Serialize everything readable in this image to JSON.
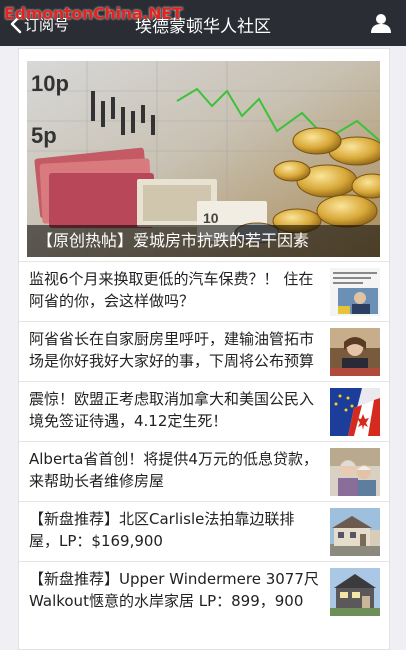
{
  "watermark": "EdmontonChina.NET",
  "nav": {
    "back_label": "订阅号",
    "title": "埃德蒙顿华人社区"
  },
  "hero": {
    "caption": "【原创热帖】爱城房市抗跌的若干因素",
    "chart_ticks": [
      "10p",
      "5p"
    ]
  },
  "articles": [
    {
      "title": "监视6个月来换取更低的汽车保费？！ 住在阿省的你，会这样做吗？",
      "thumb_icon": "news-screenshot-thumbnail"
    },
    {
      "title": "阿省省长在自家厨房里呼吁，建输油管拓市场是你好我好大家好的事，下周将公布预算",
      "thumb_icon": "premier-video-thumbnail"
    },
    {
      "title": "震惊！欧盟正考虑取消加拿大和美国公民入境免签证待遇，4.12定生死！",
      "thumb_icon": "eu-canada-flags-thumbnail"
    },
    {
      "title": "Alberta省首创！将提供4万元的低息贷款，来帮助长者维修房屋",
      "thumb_icon": "seniors-couple-thumbnail"
    },
    {
      "title": "【新盘推荐】北区Carlisle法拍靠边联排屋，LP：$169,900",
      "thumb_icon": "townhouse-thumbnail"
    },
    {
      "title": "【新盘推荐】Upper Windermere 3077尺Walkout惬意的水岸家居 LP：899，900",
      "thumb_icon": "house-thumbnail"
    }
  ],
  "colors": {
    "navbar": "#2a2d33",
    "watermark": "#e5231e",
    "page_bg": "#efeff4"
  }
}
